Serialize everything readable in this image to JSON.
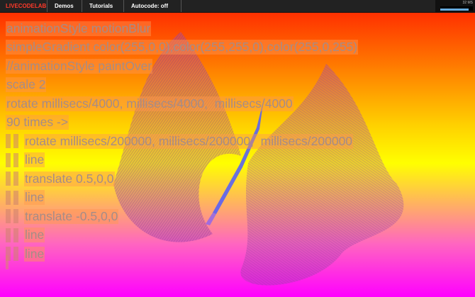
{
  "topbar": {
    "brand": "LIVECODELAB",
    "menu": [
      "Demos",
      "Tutorials",
      "Autocode: off"
    ],
    "stats_label": "32 MS"
  },
  "code": {
    "lines": [
      "animationStyle motionBlur",
      "simpleGradient color(255,0,0),color(255,255,0),color(255,0,255)",
      "//animationStyle paintOver",
      "scale 2",
      "rotate millisecs/4000, millisecs/4000,  millisecs/4000",
      "90 times ->"
    ],
    "indented_lines": [
      "rotate millisecs/200000, millisecs/200000,  millisecs/200000",
      "line",
      "translate 0.5,0,0",
      "line",
      "translate -0.5,0,0",
      "line",
      "line"
    ]
  },
  "colors": {
    "gradient": [
      "#ff0000",
      "#ffff00",
      "#ff00ff"
    ],
    "code_text": "#a58c87",
    "brand": "#ff3a2a"
  }
}
